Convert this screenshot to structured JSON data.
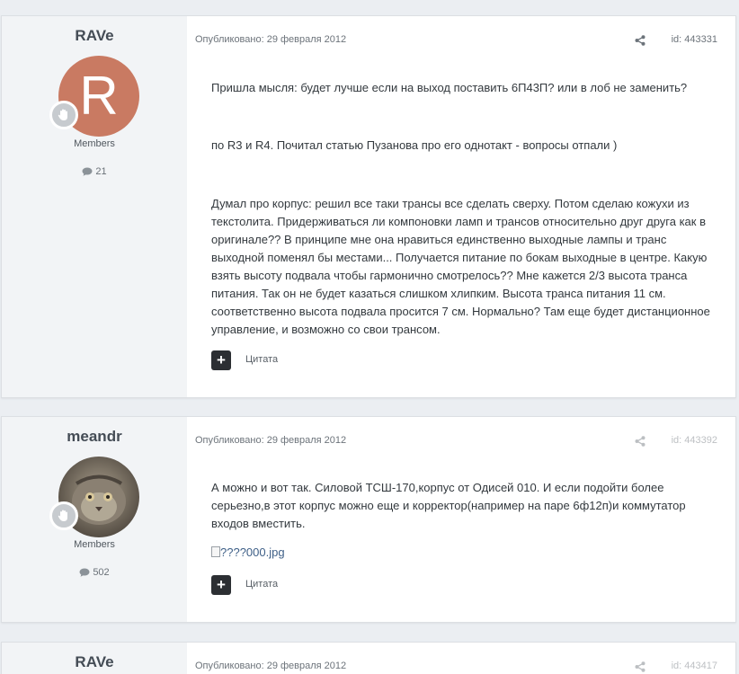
{
  "colors": {
    "page_bg": "#ebeef2",
    "author_panel_bg": "#f2f4f6",
    "avatar_letter_bg": "#c97a62",
    "quote_button_bg": "#2c2f33",
    "image_link": "#3e5f87"
  },
  "icons": {
    "share": "share-icon",
    "posts_count": "chat-bubble-icon",
    "rank_badge": "hand-badge-icon",
    "multiquote": "plus-icon"
  },
  "posts": [
    {
      "author": "RAVe",
      "avatar_letter": "R",
      "group": "Members",
      "post_count": "21",
      "date": "Опубликовано: 29 февраля 2012",
      "id": "id: 443331",
      "paragraphs": [
        "Пришла мысля: будет лучше если на выход поставить 6П43П? или в лоб не заменить?",
        "по R3 и R4. Почитал статью Пузанова про его однотакт - вопросы отпали )",
        "Думал про корпус: решил все таки трансы все сделать сверху. Потом сделаю кожухи из текстолита. Придерживаться ли компоновки ламп и трансов относительно друг друга как в оригинале?? В принципе мне она нравиться единственно выходные лампы и транс выходной поменял бы местами... Получается питание по бокам выходные в центре. Какую взять высоту подвала чтобы гармонично смотрелось?? Мне кажется 2/3 высота транса питания. Так он не будет казаться слишком хлипким. Высота транса питания 11 см. соответственно высота подвала просится 7 см. Нормально? Там еще будет дистанционное управление, и возможно со свои трансом."
      ],
      "quote_label": "Цитата"
    },
    {
      "author": "meandr",
      "group": "Members",
      "post_count": "502",
      "date": "Опубликовано: 29 февраля 2012",
      "id": "id: 443392",
      "paragraphs": [
        "А можно и вот так. Силовой ТСШ-170,корпус от Одисей 010. И если подойти более серьезно,в этот корпус можно еще и корректор(например на паре 6ф12п)и коммутатор входов вместить."
      ],
      "image_link": "????000.jpg",
      "quote_label": "Цитата"
    },
    {
      "author": "RAVe",
      "date": "Опубликовано: 29 февраля 2012",
      "id": "id: 443417"
    }
  ]
}
